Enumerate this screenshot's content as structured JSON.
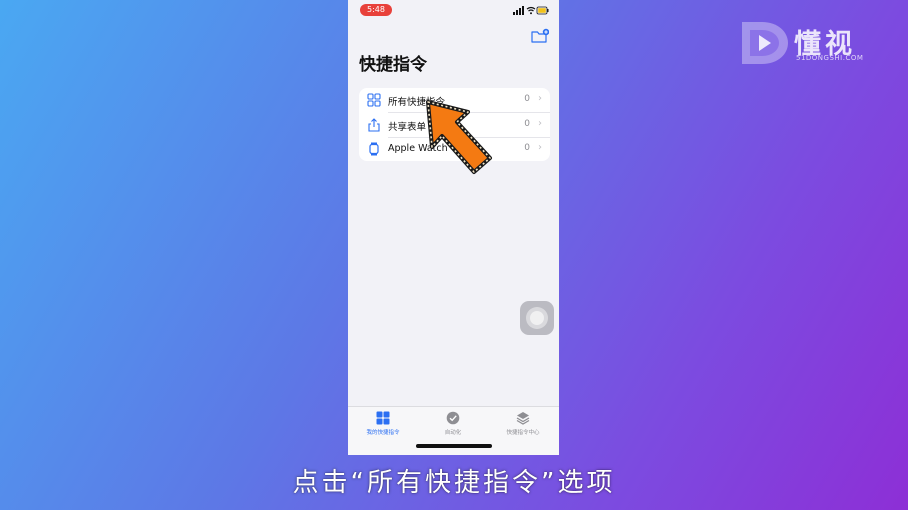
{
  "watermark": {
    "brand": "懂视",
    "url": "51DONGSHI.COM"
  },
  "status_bar": {
    "time": "5:48"
  },
  "page": {
    "title": "快捷指令"
  },
  "list": [
    {
      "icon": "grid-icon",
      "label": "所有快捷指令",
      "count": "0"
    },
    {
      "icon": "share-icon",
      "label": "共享表单",
      "count": "0"
    },
    {
      "icon": "watch-icon",
      "label": "Apple Watch",
      "count": "0"
    }
  ],
  "tabs": [
    {
      "icon": "grid-icon",
      "label": "我的快捷指令",
      "active": true
    },
    {
      "icon": "automation-check-icon",
      "label": "自动化",
      "active": false
    },
    {
      "icon": "layers-icon",
      "label": "快捷指令中心",
      "active": false
    }
  ],
  "caption": "点击“所有快捷指令”选项",
  "colors": {
    "accent": "#2b6ff2",
    "time_pill": "#e8413a",
    "arrow": "#f47a12"
  }
}
